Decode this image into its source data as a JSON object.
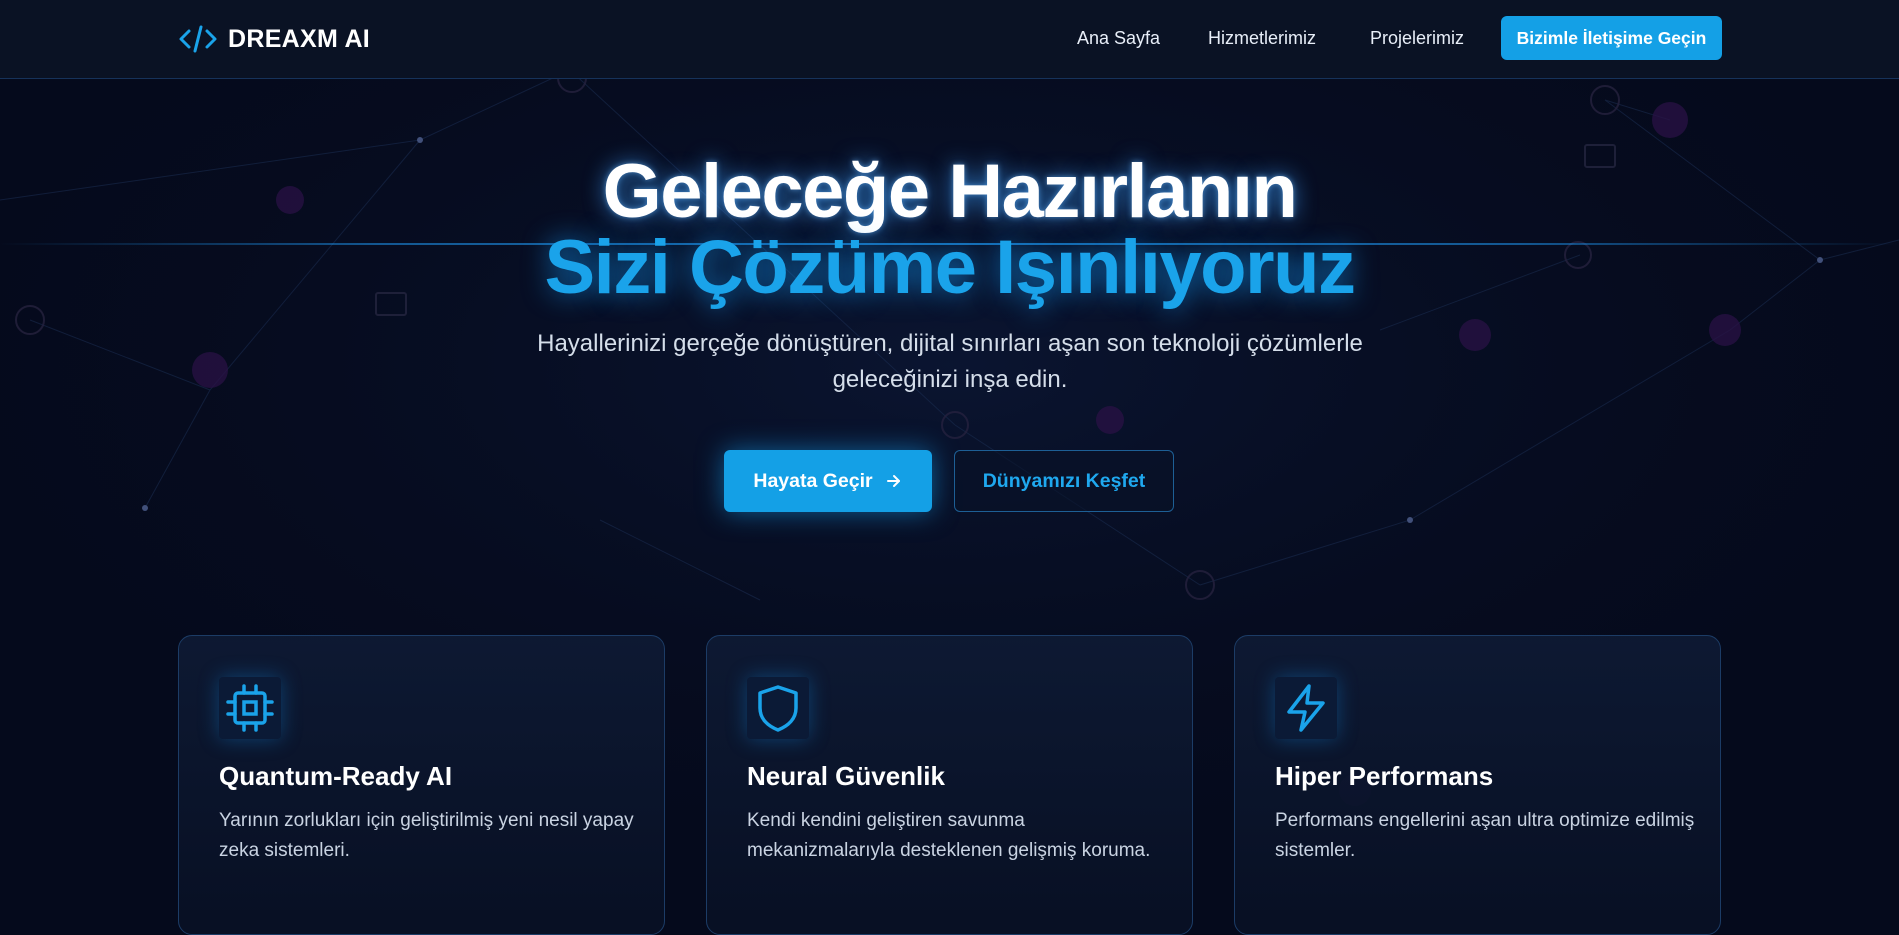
{
  "nav": {
    "brand": "DREAXM AI",
    "links": [
      "Ana Sayfa",
      "Hizmetlerimiz",
      "Projelerimiz"
    ],
    "cta": "Bizimle İletişime Geçin"
  },
  "hero": {
    "title_line1": "Geleceğe Hazırlanın",
    "title_line2": "Sizi Çözüme Işınlıyoruz",
    "subtitle_line1": "Hayallerinizi gerçeğe dönüştüren, dijital sınırları aşan son teknoloji çözümlerle",
    "subtitle_line2": "geleceğinizi inşa edin.",
    "primary_button": "Hayata Geçir",
    "secondary_button": "Dünyamızı Keşfet"
  },
  "features": [
    {
      "icon": "cpu-icon",
      "title": "Quantum-Ready AI",
      "text": "Yarının zorlukları için geliştirilmiş yeni nesil yapay zeka sistemleri."
    },
    {
      "icon": "shield-icon",
      "title": "Neural Güvenlik",
      "text": "Kendi kendini geliştiren savunma mekanizmalarıyla desteklenen gelişmiş koruma."
    },
    {
      "icon": "lightning-icon",
      "title": "Hiper Performans",
      "text": "Performans engellerini aşan ultra optimize edilmiş sistemler."
    }
  ],
  "colors": {
    "background": "#050a1c",
    "accent": "#14a0e6",
    "card_border": "#1c3c66"
  }
}
